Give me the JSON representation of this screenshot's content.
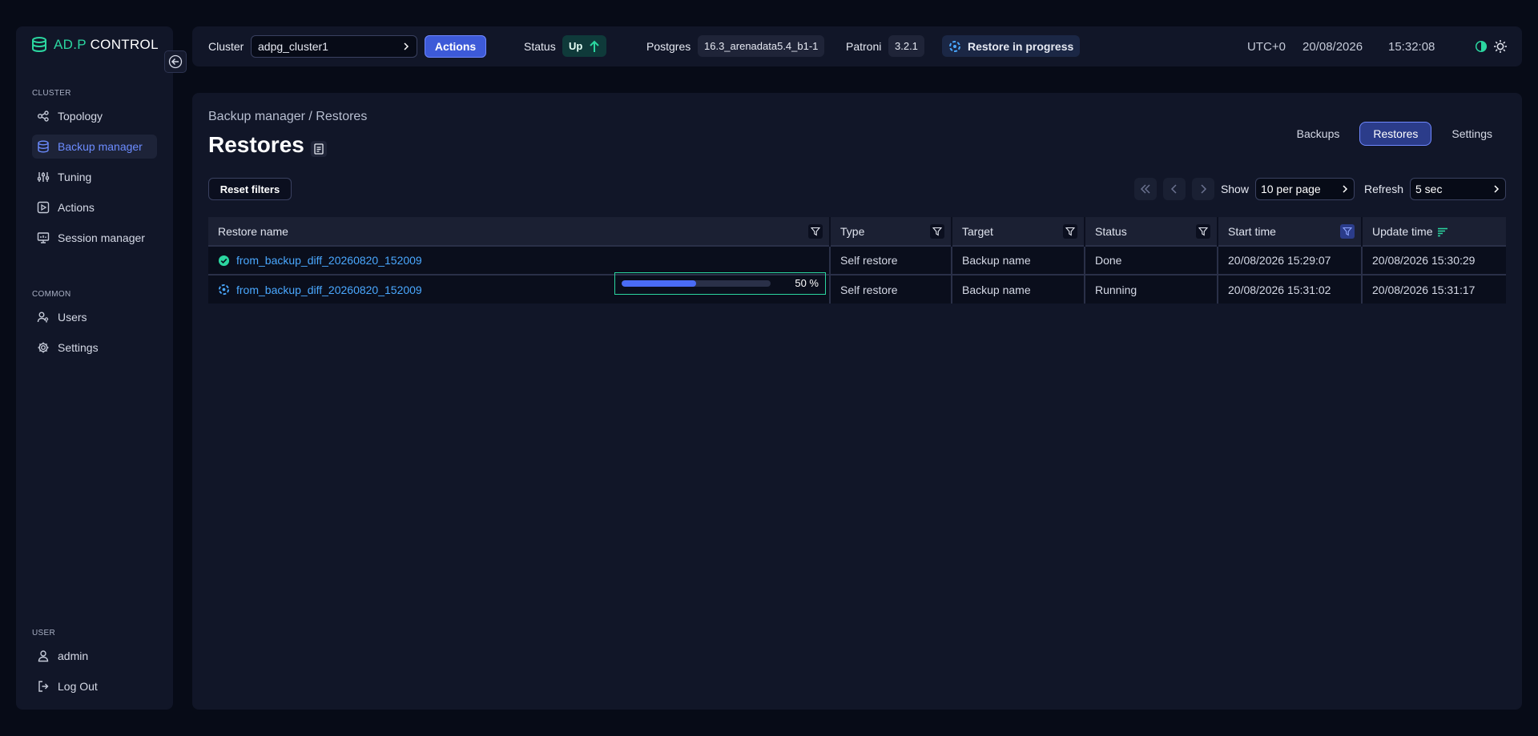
{
  "sidebar": {
    "logo_adp": "AD.P",
    "logo_control": "CONTROL",
    "section_cluster": "CLUSTER",
    "section_common": "COMMON",
    "section_user": "USER",
    "items": [
      {
        "label": "Topology",
        "icon": "topology-icon"
      },
      {
        "label": "Backup manager",
        "icon": "database-icon",
        "active": true
      },
      {
        "label": "Tuning",
        "icon": "sliders-icon"
      },
      {
        "label": "Actions",
        "icon": "play-square-icon"
      },
      {
        "label": "Session manager",
        "icon": "monitor-icon"
      }
    ],
    "common_items": [
      {
        "label": "Users",
        "icon": "users-icon"
      },
      {
        "label": "Settings",
        "icon": "gear-icon"
      }
    ],
    "user_items": [
      {
        "label": "admin",
        "icon": "user-icon"
      },
      {
        "label": "Log Out",
        "icon": "logout-icon"
      }
    ]
  },
  "topbar": {
    "cluster_label": "Cluster",
    "cluster_value": "adpg_cluster1",
    "actions_label": "Actions",
    "status_label": "Status",
    "status_value": "Up",
    "postgres_label": "Postgres",
    "postgres_version": "16.3_arenadata5.4_b1-1",
    "patroni_label": "Patroni",
    "patroni_version": "3.2.1",
    "restore_status": "Restore in progress",
    "timezone": "UTC+0",
    "date": "20/08/2026",
    "time": "15:32:08",
    "accent": "#2bd6a0"
  },
  "main": {
    "breadcrumb": "Backup manager / Restores",
    "title": "Restores",
    "tabs": [
      "Backups",
      "Restores",
      "Settings"
    ],
    "active_tab": "Restores",
    "reset_filters": "Reset filters",
    "show_label": "Show",
    "per_page": "10 per page",
    "refresh_label": "Refresh",
    "refresh_value": "5 sec"
  },
  "table": {
    "columns": [
      "Restore name",
      "Type",
      "Target",
      "Status",
      "Start time",
      "Update time"
    ],
    "rows": [
      {
        "name": "from_backup_diff_20260820_152009",
        "status_icon": "check-circle-icon",
        "type": "Self restore",
        "target": "Backup name",
        "status": "Done",
        "start": "20/08/2026 15:29:07",
        "update": "20/08/2026 15:30:29"
      },
      {
        "name": "from_backup_diff_20260820_152009",
        "status_icon": "spinner-icon",
        "progress": 0.5,
        "progress_label": "50 %",
        "type": "Self restore",
        "target": "Backup name",
        "status": "Running",
        "start": "20/08/2026 15:31:02",
        "update": "20/08/2026 15:31:17"
      }
    ]
  }
}
